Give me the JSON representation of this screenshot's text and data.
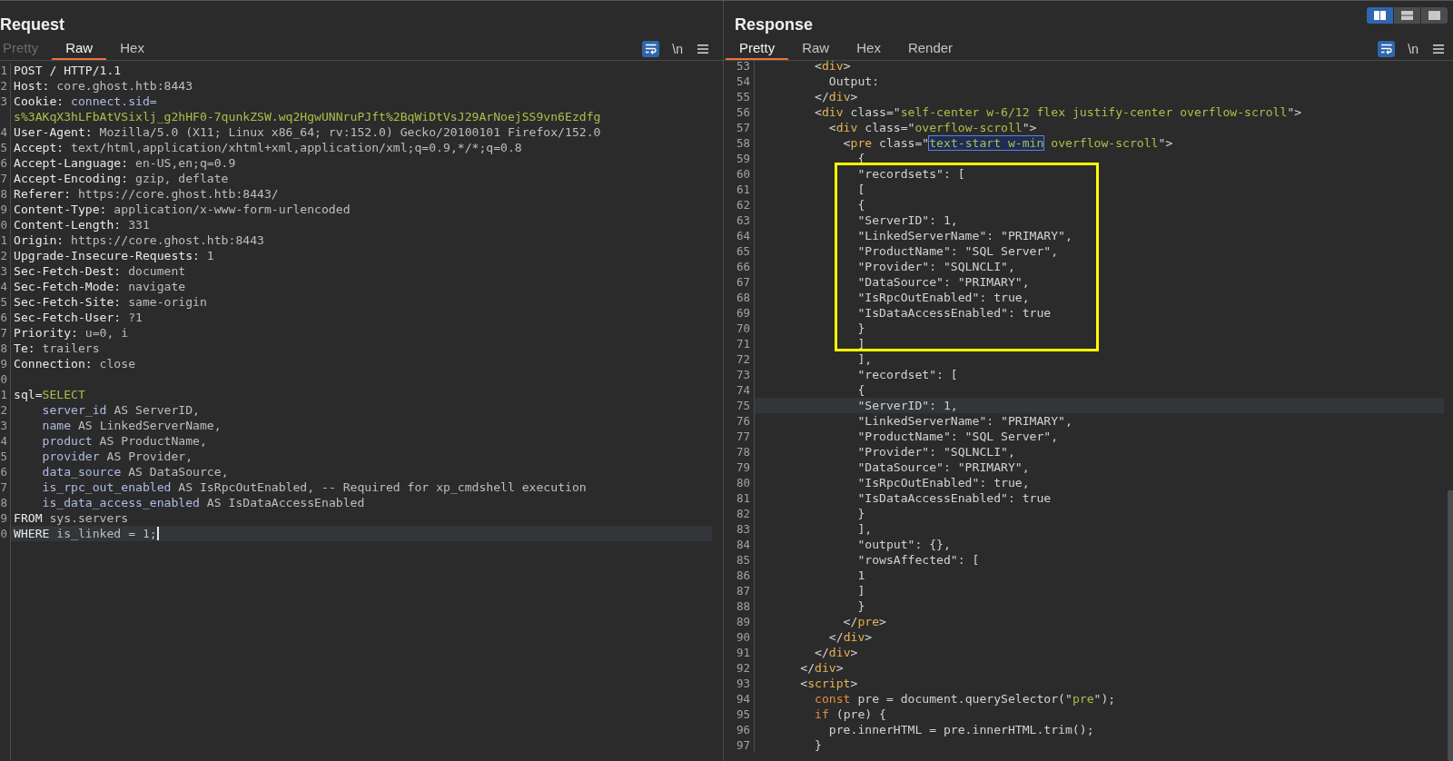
{
  "panels": [
    {
      "title": "Request",
      "tabs": [
        {
          "label": "Pretty",
          "selected": false,
          "disabled": true
        },
        {
          "label": "Raw",
          "selected": true,
          "disabled": false
        },
        {
          "label": "Hex",
          "selected": false,
          "disabled": false
        }
      ],
      "toolbar": [
        {
          "kind": "wrap",
          "on": true
        },
        {
          "kind": "newline",
          "label": "\\n",
          "on": false
        },
        {
          "kind": "menu",
          "on": false
        }
      ],
      "focused": true,
      "lines": [
        {
          "number": "1",
          "segments": [
            {
              "kind": "key",
              "text": "POST / HTTP/1.1"
            }
          ],
          "current": false
        },
        {
          "number": "2",
          "segments": [
            {
              "kind": "key",
              "text": "Host:"
            },
            {
              "kind": "value",
              "text": " core.ghost.htb:8443"
            }
          ],
          "current": false
        },
        {
          "number": "3",
          "segments": [
            {
              "kind": "key",
              "text": "Cookie:"
            },
            {
              "kind": "name",
              "text": " connect.sid="
            },
            {
              "kind": "string",
              "text": "s%3AKqX3hLFbAtVSixlj_g2hHF0-7qunkZSW.wq2HgwUNNruPJft%2BqWiDtVsJ29ArNoejSS9vn6Ezdfg"
            }
          ],
          "current": false
        },
        {
          "number": "4",
          "segments": [
            {
              "kind": "key",
              "text": "User-Agent:"
            },
            {
              "kind": "value",
              "text": " Mozilla/5.0 (X11; Linux x86_64; rv:152.0) Gecko/20100101 Firefox/152.0"
            }
          ],
          "current": false
        },
        {
          "number": "5",
          "segments": [
            {
              "kind": "key",
              "text": "Accept:"
            },
            {
              "kind": "value",
              "text": " text/html,application/xhtml+xml,application/xml;q=0.9,*/*;q=0.8"
            }
          ],
          "current": false
        },
        {
          "number": "6",
          "segments": [
            {
              "kind": "key",
              "text": "Accept-Language:"
            },
            {
              "kind": "value",
              "text": " en-US,en;q=0.9"
            }
          ],
          "current": false
        },
        {
          "number": "7",
          "segments": [
            {
              "kind": "key",
              "text": "Accept-Encoding:"
            },
            {
              "kind": "value",
              "text": " gzip, deflate"
            }
          ],
          "current": false
        },
        {
          "number": "8",
          "segments": [
            {
              "kind": "key",
              "text": "Referer:"
            },
            {
              "kind": "value",
              "text": " https://core.ghost.htb:8443/"
            }
          ],
          "current": false
        },
        {
          "number": "9",
          "segments": [
            {
              "kind": "key",
              "text": "Content-Type:"
            },
            {
              "kind": "value",
              "text": " application/x-www-form-urlencoded"
            }
          ],
          "current": false
        },
        {
          "number": "0",
          "segments": [
            {
              "kind": "key",
              "text": "Content-Length:"
            },
            {
              "kind": "value",
              "text": " 331"
            }
          ],
          "current": false
        },
        {
          "number": "1",
          "segments": [
            {
              "kind": "key",
              "text": "Origin:"
            },
            {
              "kind": "value",
              "text": " https://core.ghost.htb:8443"
            }
          ],
          "current": false
        },
        {
          "number": "2",
          "segments": [
            {
              "kind": "key",
              "text": "Upgrade-Insecure-Requests:"
            },
            {
              "kind": "value",
              "text": " 1"
            }
          ],
          "current": false
        },
        {
          "number": "3",
          "segments": [
            {
              "kind": "key",
              "text": "Sec-Fetch-Dest:"
            },
            {
              "kind": "value",
              "text": " document"
            }
          ],
          "current": false
        },
        {
          "number": "4",
          "segments": [
            {
              "kind": "key",
              "text": "Sec-Fetch-Mode:"
            },
            {
              "kind": "value",
              "text": " navigate"
            }
          ],
          "current": false
        },
        {
          "number": "5",
          "segments": [
            {
              "kind": "key",
              "text": "Sec-Fetch-Site:"
            },
            {
              "kind": "value",
              "text": " same-origin"
            }
          ],
          "current": false
        },
        {
          "number": "6",
          "segments": [
            {
              "kind": "key",
              "text": "Sec-Fetch-User:"
            },
            {
              "kind": "value",
              "text": " ?1"
            }
          ],
          "current": false
        },
        {
          "number": "7",
          "segments": [
            {
              "kind": "key",
              "text": "Priority:"
            },
            {
              "kind": "value",
              "text": " u=0, i"
            }
          ],
          "current": false
        },
        {
          "number": "8",
          "segments": [
            {
              "kind": "key",
              "text": "Te:"
            },
            {
              "kind": "value",
              "text": " trailers"
            }
          ],
          "current": false
        },
        {
          "number": "9",
          "segments": [
            {
              "kind": "key",
              "text": "Connection:"
            },
            {
              "kind": "value",
              "text": " close"
            }
          ],
          "current": false
        },
        {
          "number": "0",
          "current": false
        },
        {
          "number": "1",
          "segments": [
            {
              "kind": "key",
              "text": "sql="
            },
            {
              "kind": "string",
              "text": "SELECT"
            }
          ],
          "current": false
        },
        {
          "number": "2",
          "segments": [
            {
              "kind": "name",
              "text": "    server_id"
            },
            {
              "kind": "value",
              "text": " AS ServerID,"
            }
          ],
          "current": false
        },
        {
          "number": "3",
          "segments": [
            {
              "kind": "name",
              "text": "    name"
            },
            {
              "kind": "value",
              "text": " AS LinkedServerName,"
            }
          ],
          "current": false
        },
        {
          "number": "4",
          "segments": [
            {
              "kind": "name",
              "text": "    product"
            },
            {
              "kind": "value",
              "text": " AS ProductName,"
            }
          ],
          "current": false
        },
        {
          "number": "5",
          "segments": [
            {
              "kind": "name",
              "text": "    provider"
            },
            {
              "kind": "value",
              "text": " AS Provider,"
            }
          ],
          "current": false
        },
        {
          "number": "6",
          "segments": [
            {
              "kind": "name",
              "text": "    data_source"
            },
            {
              "kind": "value",
              "text": " AS DataSource,"
            }
          ],
          "current": false
        },
        {
          "number": "7",
          "segments": [
            {
              "kind": "name",
              "text": "    is_rpc_out_enabled"
            },
            {
              "kind": "value",
              "text": " AS IsRpcOutEnabled, -- Required for xp_cmdshell execution"
            }
          ],
          "current": false
        },
        {
          "number": "8",
          "segments": [
            {
              "kind": "name",
              "text": "    is_data_access_enabled"
            },
            {
              "kind": "value",
              "text": " AS IsDataAccessEnabled"
            }
          ],
          "current": false
        },
        {
          "number": "9",
          "segments": [
            {
              "kind": "key",
              "text": "FROM"
            },
            {
              "kind": "value",
              "text": " sys.servers"
            }
          ],
          "current": false
        },
        {
          "number": "0",
          "segments": [
            {
              "kind": "key",
              "text": "WHERE"
            },
            {
              "kind": "value",
              "text": " is_linked = 1;"
            }
          ],
          "current": true
        }
      ]
    },
    {
      "title": "Response",
      "layout_buttons": [
        {
          "kind": "columns",
          "selected": true
        },
        {
          "kind": "rows",
          "selected": false
        },
        {
          "kind": "single",
          "selected": false
        }
      ],
      "tabs": [
        {
          "label": "Pretty",
          "selected": true,
          "disabled": false
        },
        {
          "label": "Raw",
          "selected": false,
          "disabled": false
        },
        {
          "label": "Hex",
          "selected": false,
          "disabled": false
        },
        {
          "label": "Render",
          "selected": false,
          "disabled": false
        }
      ],
      "toolbar": [
        {
          "kind": "wrap",
          "on": true
        },
        {
          "kind": "newline",
          "label": "\\n",
          "on": false
        },
        {
          "kind": "menu",
          "on": false
        }
      ],
      "focused": false,
      "blocks": [
        {
          "boxed": false,
          "lines": [
            {
              "number": "53",
              "segments": [
                {
                  "kind": "plain",
                  "text": "        <"
                },
                {
                  "kind": "tag",
                  "text": "div"
                },
                {
                  "kind": "plain",
                  "text": ">"
                }
              ],
              "current": false
            },
            {
              "number": "54",
              "segments": [
                {
                  "kind": "plain",
                  "text": "          Output:"
                }
              ],
              "current": false
            },
            {
              "number": "55",
              "segments": [
                {
                  "kind": "plain",
                  "text": "        </"
                },
                {
                  "kind": "tag",
                  "text": "div"
                },
                {
                  "kind": "plain",
                  "text": ">"
                }
              ],
              "current": false
            },
            {
              "number": "56",
              "segments": [
                {
                  "kind": "plain",
                  "text": "        <"
                },
                {
                  "kind": "tag",
                  "text": "div"
                },
                {
                  "kind": "plain",
                  "text": " class=\""
                },
                {
                  "kind": "string",
                  "text": "self-center w-6/12 flex justify-center overflow-scroll"
                },
                {
                  "kind": "plain",
                  "text": "\">"
                }
              ],
              "current": false
            },
            {
              "number": "57",
              "segments": [
                {
                  "kind": "plain",
                  "text": "          <"
                },
                {
                  "kind": "tag",
                  "text": "div"
                },
                {
                  "kind": "plain",
                  "text": " class=\""
                },
                {
                  "kind": "string",
                  "text": "overflow-scroll"
                },
                {
                  "kind": "plain",
                  "text": "\">"
                }
              ],
              "current": false
            },
            {
              "number": "58",
              "segments": [
                {
                  "kind": "plain",
                  "text": "            <"
                },
                {
                  "kind": "tag",
                  "text": "pre"
                },
                {
                  "kind": "plain",
                  "text": " class=\""
                },
                {
                  "kind": "match",
                  "text": "text-start w-min"
                },
                {
                  "kind": "string",
                  "text": " overflow-scroll"
                },
                {
                  "kind": "plain",
                  "text": "\">"
                }
              ],
              "current": false
            },
            {
              "number": "59",
              "segments": [
                {
                  "kind": "plain",
                  "text": "              {"
                }
              ],
              "current": false
            }
          ]
        },
        {
          "boxed": true,
          "lines": [
            {
              "number": "60",
              "segments": [
                {
                  "kind": "plain",
                  "text": "              \"recordsets\": ["
                }
              ],
              "current": false
            },
            {
              "number": "61",
              "segments": [
                {
                  "kind": "plain",
                  "text": "              ["
                }
              ],
              "current": false
            },
            {
              "number": "62",
              "segments": [
                {
                  "kind": "plain",
                  "text": "              {"
                }
              ],
              "current": false
            },
            {
              "number": "63",
              "segments": [
                {
                  "kind": "plain",
                  "text": "              \"ServerID\": 1,"
                }
              ],
              "current": false
            },
            {
              "number": "64",
              "segments": [
                {
                  "kind": "plain",
                  "text": "              \"LinkedServerName\": \"PRIMARY\","
                }
              ],
              "current": false
            },
            {
              "number": "65",
              "segments": [
                {
                  "kind": "plain",
                  "text": "              \"ProductName\": \"SQL Server\","
                }
              ],
              "current": false
            },
            {
              "number": "66",
              "segments": [
                {
                  "kind": "plain",
                  "text": "              \"Provider\": \"SQLNCLI\","
                }
              ],
              "current": false
            },
            {
              "number": "67",
              "segments": [
                {
                  "kind": "plain",
                  "text": "              \"DataSource\": \"PRIMARY\","
                }
              ],
              "current": false
            },
            {
              "number": "68",
              "segments": [
                {
                  "kind": "plain",
                  "text": "              \"IsRpcOutEnabled\": true,"
                }
              ],
              "current": false
            },
            {
              "number": "69",
              "segments": [
                {
                  "kind": "plain",
                  "text": "              \"IsDataAccessEnabled\": true"
                }
              ],
              "current": false
            },
            {
              "number": "70",
              "segments": [
                {
                  "kind": "plain",
                  "text": "              }"
                }
              ],
              "current": false
            },
            {
              "number": "71",
              "segments": [
                {
                  "kind": "plain",
                  "text": "              ]"
                }
              ],
              "current": false
            }
          ]
        },
        {
          "boxed": false,
          "lines": [
            {
              "number": "72",
              "segments": [
                {
                  "kind": "plain",
                  "text": "              ],"
                }
              ],
              "current": false
            },
            {
              "number": "73",
              "segments": [
                {
                  "kind": "plain",
                  "text": "              \"recordset\": ["
                }
              ],
              "current": false
            },
            {
              "number": "74",
              "segments": [
                {
                  "kind": "plain",
                  "text": "              {"
                }
              ],
              "current": false
            },
            {
              "number": "75",
              "segments": [
                {
                  "kind": "plain",
                  "text": "              \"ServerID\": 1,"
                }
              ],
              "current": true
            },
            {
              "number": "76",
              "segments": [
                {
                  "kind": "plain",
                  "text": "              \"LinkedServerName\": \"PRIMARY\","
                }
              ],
              "current": false
            },
            {
              "number": "77",
              "segments": [
                {
                  "kind": "plain",
                  "text": "              \"ProductName\": \"SQL Server\","
                }
              ],
              "current": false
            },
            {
              "number": "78",
              "segments": [
                {
                  "kind": "plain",
                  "text": "              \"Provider\": \"SQLNCLI\","
                }
              ],
              "current": false
            },
            {
              "number": "79",
              "segments": [
                {
                  "kind": "plain",
                  "text": "              \"DataSource\": \"PRIMARY\","
                }
              ],
              "current": false
            },
            {
              "number": "80",
              "segments": [
                {
                  "kind": "plain",
                  "text": "              \"IsRpcOutEnabled\": true,"
                }
              ],
              "current": false
            },
            {
              "number": "81",
              "segments": [
                {
                  "kind": "plain",
                  "text": "              \"IsDataAccessEnabled\": true"
                }
              ],
              "current": false
            },
            {
              "number": "82",
              "segments": [
                {
                  "kind": "plain",
                  "text": "              }"
                }
              ],
              "current": false
            },
            {
              "number": "83",
              "segments": [
                {
                  "kind": "plain",
                  "text": "              ],"
                }
              ],
              "current": false
            },
            {
              "number": "84",
              "segments": [
                {
                  "kind": "plain",
                  "text": "              \"output\": {},"
                }
              ],
              "current": false
            },
            {
              "number": "85",
              "segments": [
                {
                  "kind": "plain",
                  "text": "              \"rowsAffected\": ["
                }
              ],
              "current": false
            },
            {
              "number": "86",
              "segments": [
                {
                  "kind": "plain",
                  "text": "              1"
                }
              ],
              "current": false
            },
            {
              "number": "87",
              "segments": [
                {
                  "kind": "plain",
                  "text": "              ]"
                }
              ],
              "current": false
            },
            {
              "number": "88",
              "segments": [
                {
                  "kind": "plain",
                  "text": "              }"
                }
              ],
              "current": false
            },
            {
              "number": "89",
              "segments": [
                {
                  "kind": "plain",
                  "text": "            </"
                },
                {
                  "kind": "tag",
                  "text": "pre"
                },
                {
                  "kind": "plain",
                  "text": ">"
                }
              ],
              "current": false
            },
            {
              "number": "90",
              "segments": [
                {
                  "kind": "plain",
                  "text": "          </"
                },
                {
                  "kind": "tag",
                  "text": "div"
                },
                {
                  "kind": "plain",
                  "text": ">"
                }
              ],
              "current": false
            },
            {
              "number": "91",
              "segments": [
                {
                  "kind": "plain",
                  "text": "        </"
                },
                {
                  "kind": "tag",
                  "text": "div"
                },
                {
                  "kind": "plain",
                  "text": ">"
                }
              ],
              "current": false
            },
            {
              "number": "92",
              "segments": [
                {
                  "kind": "plain",
                  "text": "      </"
                },
                {
                  "kind": "tag",
                  "text": "div"
                },
                {
                  "kind": "plain",
                  "text": ">"
                }
              ],
              "current": false
            },
            {
              "number": "93",
              "segments": [
                {
                  "kind": "plain",
                  "text": "      <"
                },
                {
                  "kind": "tag",
                  "text": "script"
                },
                {
                  "kind": "plain",
                  "text": ">"
                }
              ],
              "current": false
            },
            {
              "number": "94",
              "segments": [
                {
                  "kind": "keyword",
                  "text": "        const"
                },
                {
                  "kind": "plain",
                  "text": " pre = document.querySelector(\""
                },
                {
                  "kind": "string",
                  "text": "pre"
                },
                {
                  "kind": "plain",
                  "text": "\");"
                }
              ],
              "current": false
            },
            {
              "number": "95",
              "segments": [
                {
                  "kind": "keyword",
                  "text": "        if"
                },
                {
                  "kind": "plain",
                  "text": " (pre) {"
                }
              ],
              "current": false
            },
            {
              "number": "96",
              "segments": [
                {
                  "kind": "plain",
                  "text": "          pre.innerHTML = pre.innerHTML.trim();"
                }
              ],
              "current": false
            },
            {
              "number": "97",
              "segments": [
                {
                  "kind": "plain",
                  "text": "        }"
                }
              ],
              "current": false
            }
          ]
        }
      ]
    }
  ]
}
